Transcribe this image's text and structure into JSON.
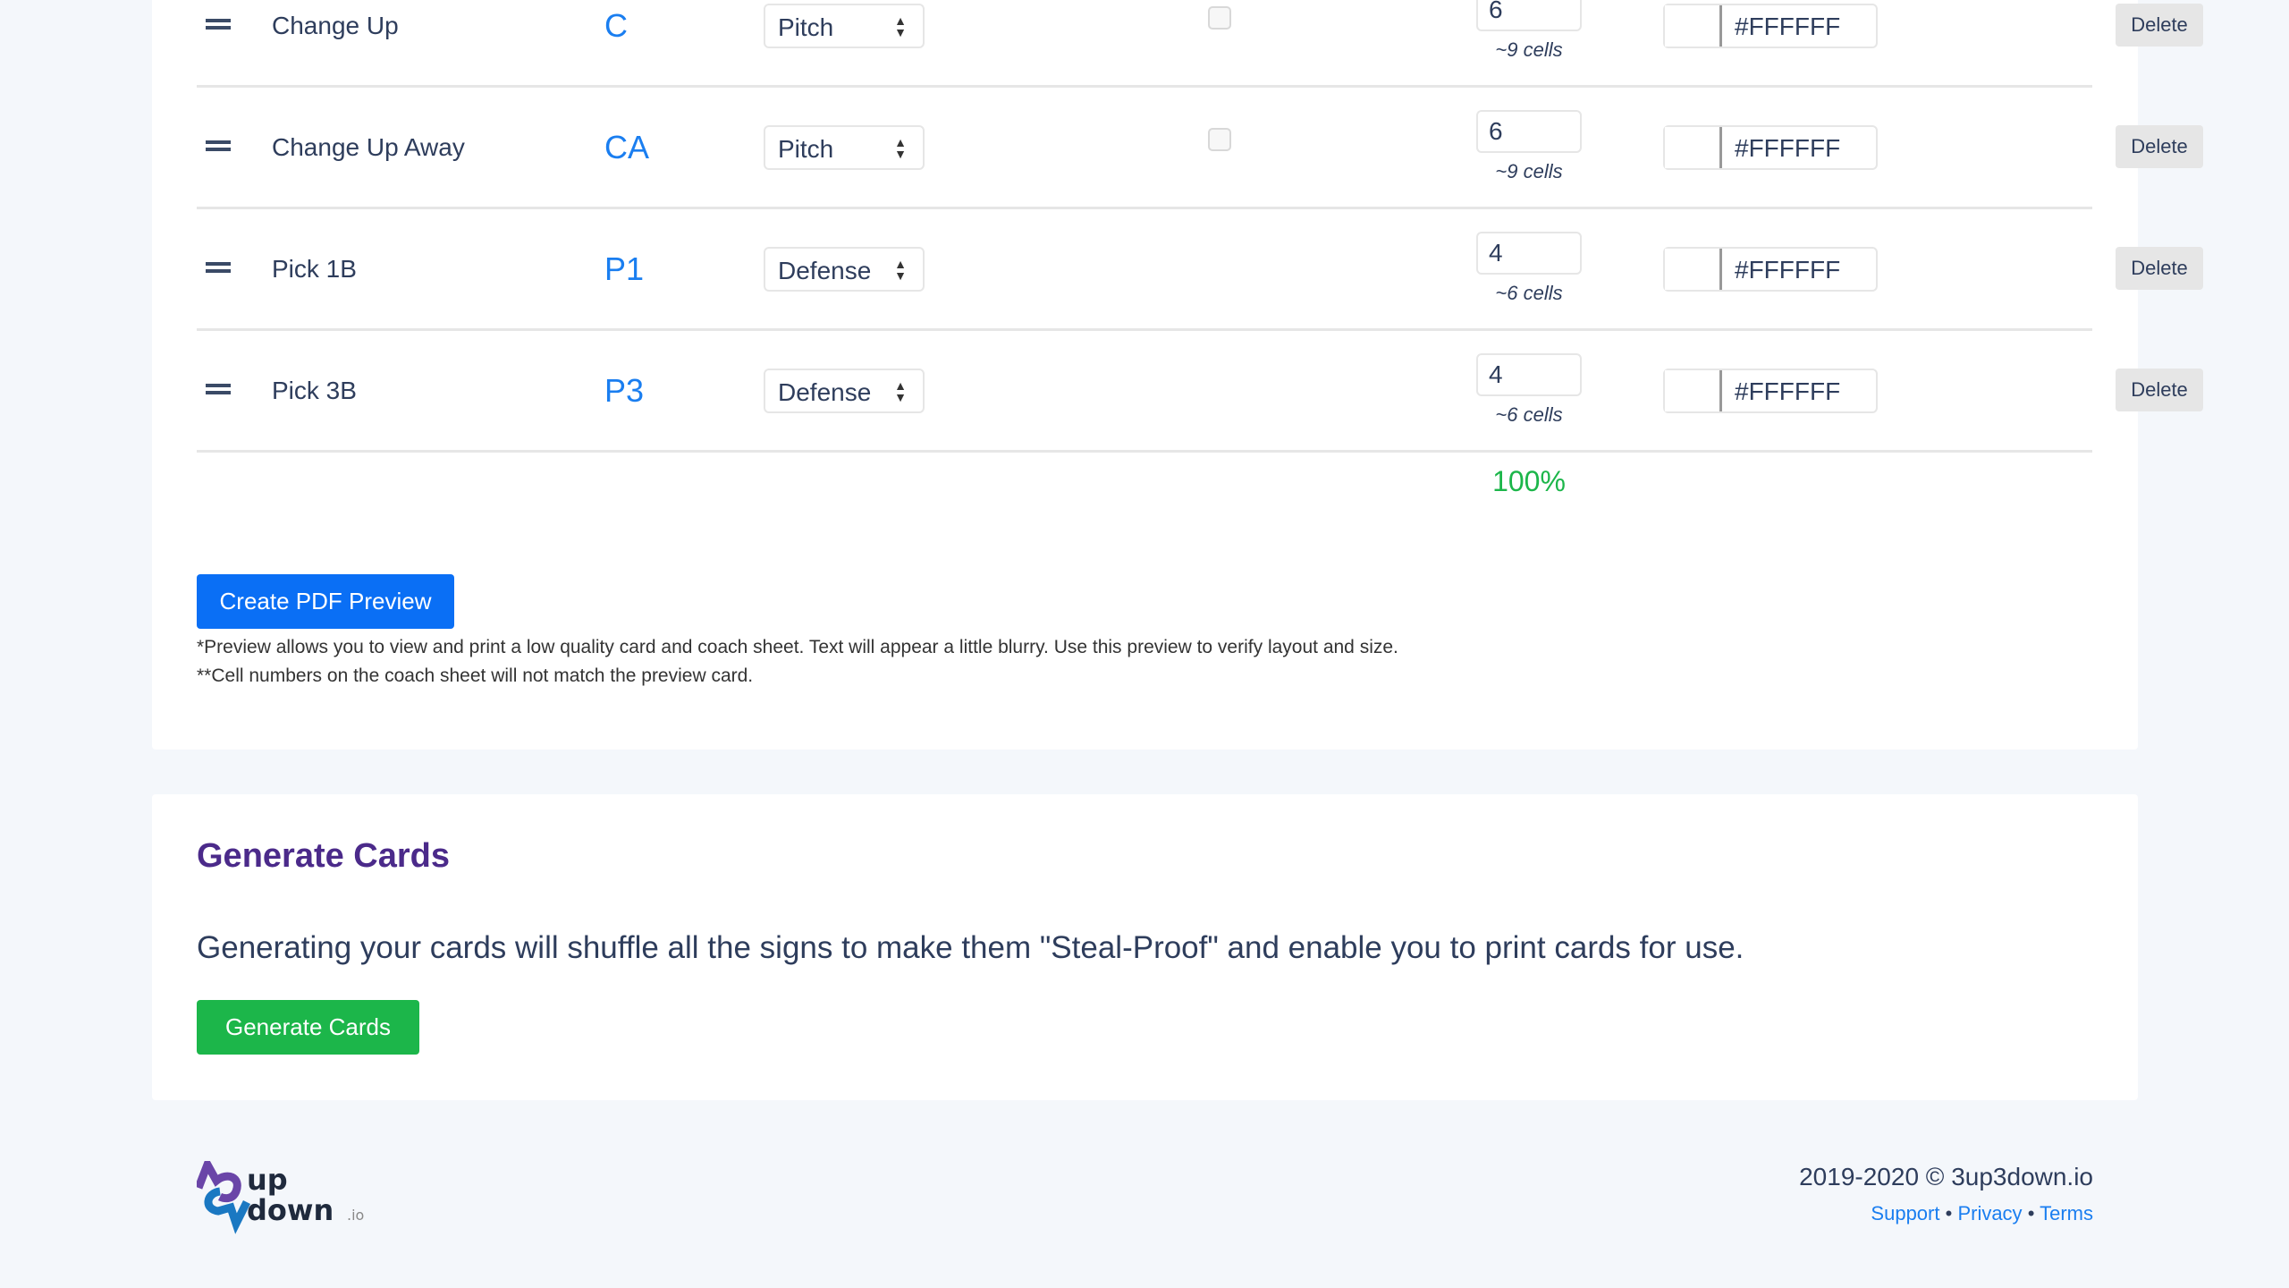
{
  "rows": [
    {
      "name": "Change Up",
      "abbr": "C",
      "type": "Pitch",
      "has_checkbox": true,
      "count": "6",
      "cells": "~9 cells",
      "color": "#FFFFFF",
      "delete": "Delete"
    },
    {
      "name": "Change Up Away",
      "abbr": "CA",
      "type": "Pitch",
      "has_checkbox": true,
      "count": "6",
      "cells": "~9 cells",
      "color": "#FFFFFF",
      "delete": "Delete"
    },
    {
      "name": "Pick 1B",
      "abbr": "P1",
      "type": "Defense",
      "has_checkbox": false,
      "count": "4",
      "cells": "~6 cells",
      "color": "#FFFFFF",
      "delete": "Delete"
    },
    {
      "name": "Pick 3B",
      "abbr": "P3",
      "type": "Defense",
      "has_checkbox": false,
      "count": "4",
      "cells": "~6 cells",
      "color": "#FFFFFF",
      "delete": "Delete"
    }
  ],
  "total_percent": "100%",
  "preview": {
    "button": "Create PDF Preview",
    "note1": "*Preview allows you to view and print a low quality card and coach sheet. Text will appear a little blurry. Use this preview to verify layout and size.",
    "note2": "**Cell numbers on the coach sheet will not match the preview card."
  },
  "generate": {
    "title": "Generate Cards",
    "text": "Generating your cards will shuffle all the signs to make them \"Steal-Proof\" and enable you to print cards for use.",
    "button": "Generate Cards"
  },
  "footer": {
    "logo_text": "3 up 3 down .io",
    "copyright": "2019-2020 © 3up3down.io",
    "links": [
      "Support",
      "Privacy",
      "Terms"
    ],
    "sep": "•"
  },
  "colors": {
    "primary": "#0a6ff5",
    "success": "#1cb64a",
    "heading": "#4b2a8a",
    "abbr": "#1a7ef0"
  }
}
